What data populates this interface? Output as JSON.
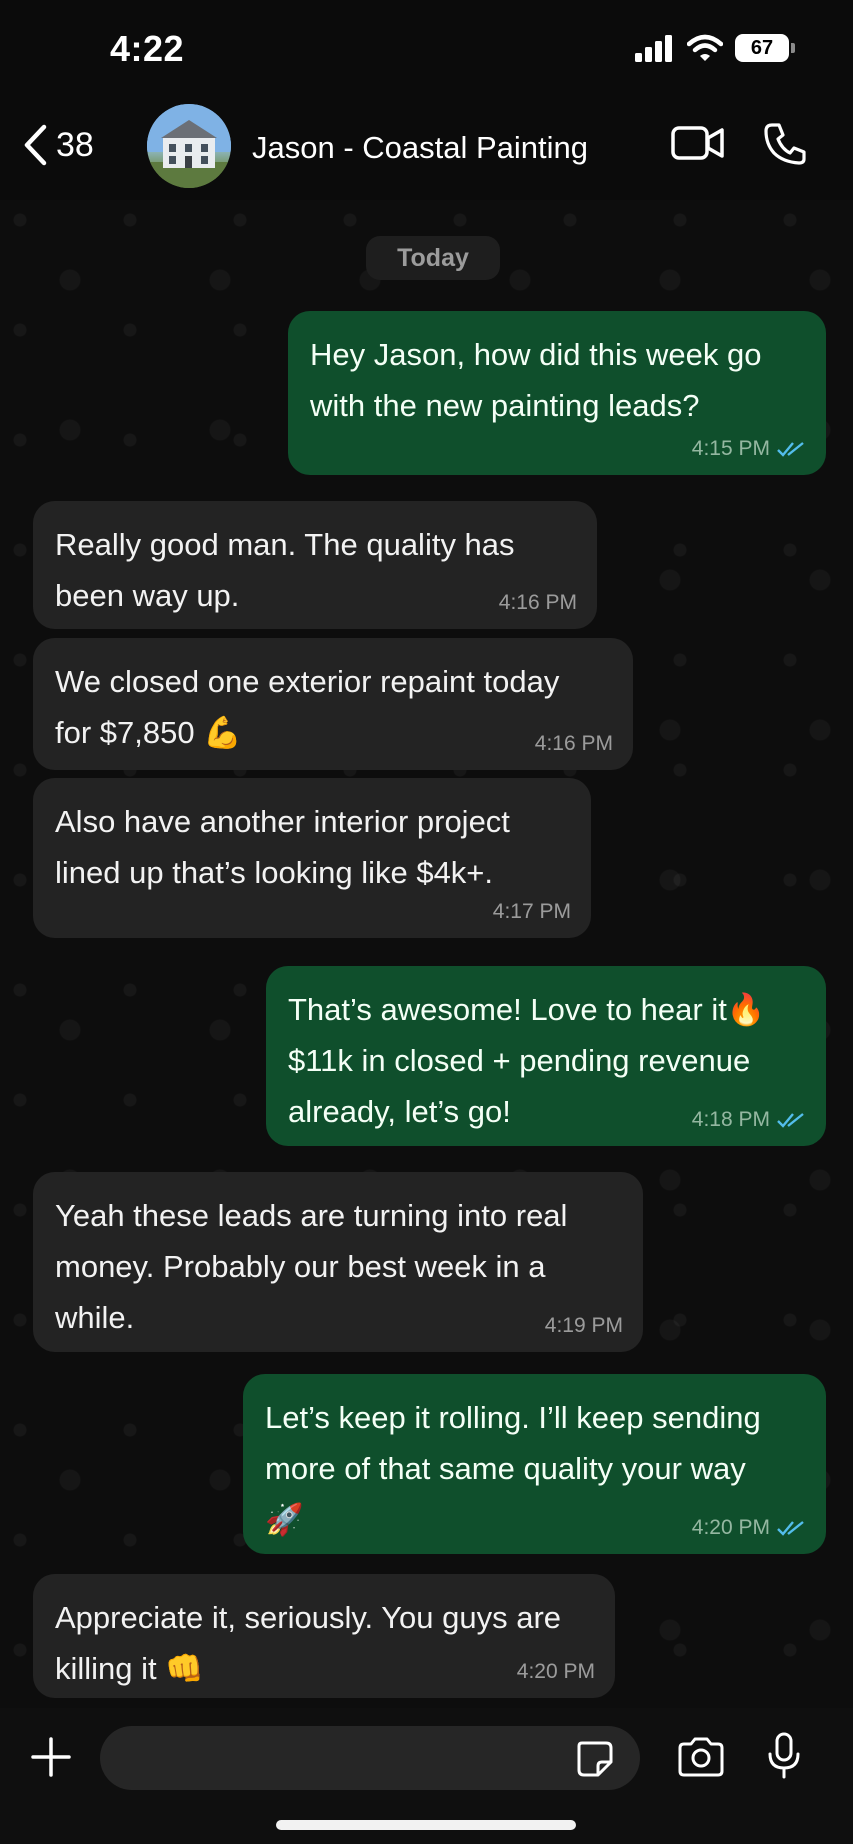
{
  "status_bar": {
    "time": "4:22",
    "battery": "67"
  },
  "header": {
    "back_count": "38",
    "contact_name": "Jason - Coastal Painting"
  },
  "chat": {
    "date_label": "Today",
    "messages": [
      {
        "direction": "outgoing",
        "text": "Hey Jason, how did this week go\nwith the new painting leads?",
        "time": "4:15 PM",
        "read": true
      },
      {
        "direction": "incoming",
        "text": "Really good man. The quality has\nbeen way up.",
        "time": "4:16 PM"
      },
      {
        "direction": "incoming",
        "text": "We closed one exterior repaint today\nfor $7,850 💪",
        "time": "4:16 PM"
      },
      {
        "direction": "incoming",
        "text": "Also have another interior project\nlined up that’s looking like $4k+.",
        "time": "4:17 PM"
      },
      {
        "direction": "outgoing",
        "text": "That’s awesome! Love to hear it🔥\n$11k in closed + pending revenue\nalready, let’s go!",
        "time": "4:18 PM",
        "read": true
      },
      {
        "direction": "incoming",
        "text": "Yeah these leads are turning into real\nmoney. Probably our best week in a\nwhile.",
        "time": "4:19 PM"
      },
      {
        "direction": "outgoing",
        "text": "Let’s keep it rolling. I’ll keep sending\nmore of that same quality your way\n🚀",
        "time": "4:20 PM",
        "read": true
      },
      {
        "direction": "incoming",
        "text": "Appreciate it, seriously. You guys are\nkilling it 👊",
        "time": "4:20 PM"
      }
    ]
  },
  "colors": {
    "outgoing_bubble": "#0f4f2c",
    "incoming_bubble": "#232323",
    "read_ticks": "#53bdeb"
  },
  "icons": [
    "back-chevron-icon",
    "video-call-icon",
    "phone-icon",
    "plus-icon",
    "sticker-icon",
    "camera-icon",
    "microphone-icon"
  ]
}
